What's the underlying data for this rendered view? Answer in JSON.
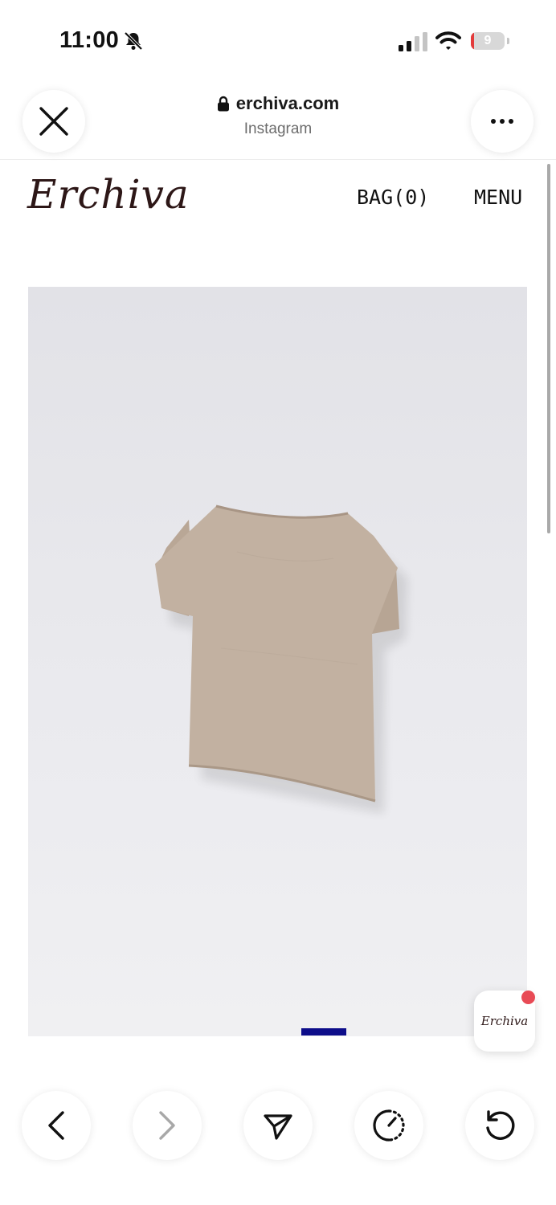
{
  "status_bar": {
    "time": "11:00",
    "battery_level": "9",
    "battery_percent": 9,
    "icons": [
      "bell-muted-icon",
      "signal-icon",
      "wifi-icon",
      "battery-icon"
    ]
  },
  "browser": {
    "url": "erchiva.com",
    "subtitle": "Instagram",
    "icons": [
      "close-icon",
      "lock-icon",
      "more-icon"
    ]
  },
  "site": {
    "logo": "Erchiva",
    "bag": "BAG(0)",
    "menu": "MENU"
  },
  "colors": {
    "logo": "#2d1717",
    "carousel_indicator": "#0d0d8a",
    "notification_dot": "#e84a55",
    "garment": "#c1b0a0"
  },
  "chat": {
    "logo": "Erchiva"
  },
  "bottom_nav": {
    "icons": [
      "back-icon",
      "forward-icon",
      "share-icon",
      "speed-icon",
      "reload-icon"
    ]
  }
}
